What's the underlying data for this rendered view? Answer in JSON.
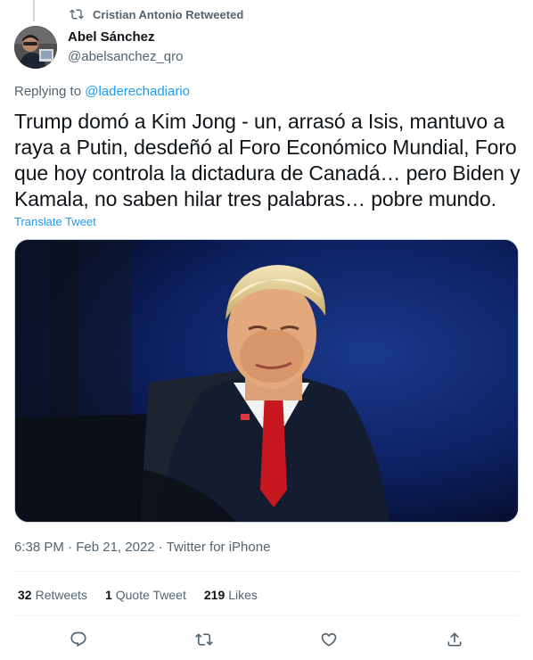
{
  "retweet_context": {
    "text": "Cristian Antonio Retweeted",
    "icon": "retweet-icon"
  },
  "author": {
    "display_name": "Abel Sánchez",
    "handle": "@abelsanchez_qro"
  },
  "replying": {
    "prefix": "Replying to ",
    "mention": "@laderechadiario"
  },
  "tweet": {
    "text": "Trump domó a Kim Jong - un, arrasó a Isis, mantuvo a raya a Putin, desdeñó al Foro Económico Mundial, Foro que hoy controla la dictadura de Canadá… pero Biden y Kamala, no saben hilar tres palabras… pobre mundo.",
    "translate_label": "Translate Tweet"
  },
  "meta": {
    "time": "6:38 PM",
    "separator": " · ",
    "date": "Feb 21, 2022",
    "source": "Twitter for iPhone"
  },
  "stats": {
    "retweets_count": "32",
    "retweets_label": "Retweets",
    "quotes_count": "1",
    "quotes_label": "Quote Tweet",
    "likes_count": "219",
    "likes_label": "Likes"
  },
  "actions": [
    {
      "icon": "reply-icon"
    },
    {
      "icon": "retweet-icon"
    },
    {
      "icon": "like-icon"
    },
    {
      "icon": "share-icon"
    }
  ],
  "colors": {
    "accent": "#1d9bf0",
    "text_primary": "#0f1419",
    "text_secondary": "#536471",
    "divider": "#eff3f4"
  }
}
